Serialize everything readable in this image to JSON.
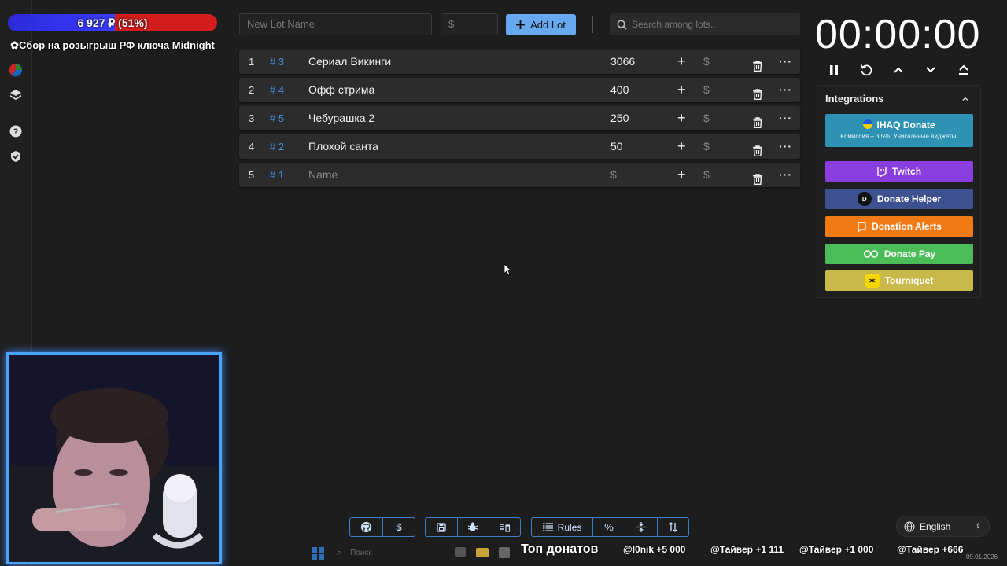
{
  "goal": {
    "amount_text": "6 927 ₽ (51%)",
    "percent": 51,
    "title": "Сбор на розыгрыш РФ ключа Midnight"
  },
  "toolbar": {
    "lot_name_placeholder": "New Lot Name",
    "amount_placeholder": "$",
    "add_label": "Add Lot",
    "search_placeholder": "Search among lots..."
  },
  "lots": [
    {
      "num": "1",
      "id": "# 3",
      "name": "Сериал Викинги",
      "amount": "3066"
    },
    {
      "num": "2",
      "id": "# 4",
      "name": "Офф стрима",
      "amount": "400"
    },
    {
      "num": "3",
      "id": "# 5",
      "name": "Чебурашка 2",
      "amount": "250"
    },
    {
      "num": "4",
      "id": "# 2",
      "name": "Плохой санта",
      "amount": "50"
    },
    {
      "num": "5",
      "id": "# 1",
      "name": "Name",
      "amount": "$"
    }
  ],
  "lot_dollar": "$",
  "timer": {
    "time": "00:00:00"
  },
  "integrations": {
    "title": "Integrations",
    "ihaq": {
      "label": "IHAQ Donate",
      "sub": "Комиссия – 3,5%. Уникальные виджеты!",
      "color": "#2e92b5"
    },
    "items": [
      {
        "label": "Twitch",
        "color": "#8a3ee0"
      },
      {
        "label": "Donate Helper",
        "color": "#3d5190"
      },
      {
        "label": "Donation Alerts",
        "color": "#f27a14"
      },
      {
        "label": "Donate Pay",
        "color": "#4cbc58"
      },
      {
        "label": "Tourniquet",
        "color": "#c9b84a"
      }
    ]
  },
  "bottom": {
    "rules_label": "Rules",
    "language": "English"
  },
  "taskbar": {
    "search_label": "Поиск",
    "date": "09.01.2026"
  },
  "ticker": {
    "title": "Топ донатов",
    "entries": [
      "@l0nik +5 000",
      "@Тайвер +1 111",
      "@Тайвер +1 000",
      "@Тайвер +666"
    ]
  }
}
